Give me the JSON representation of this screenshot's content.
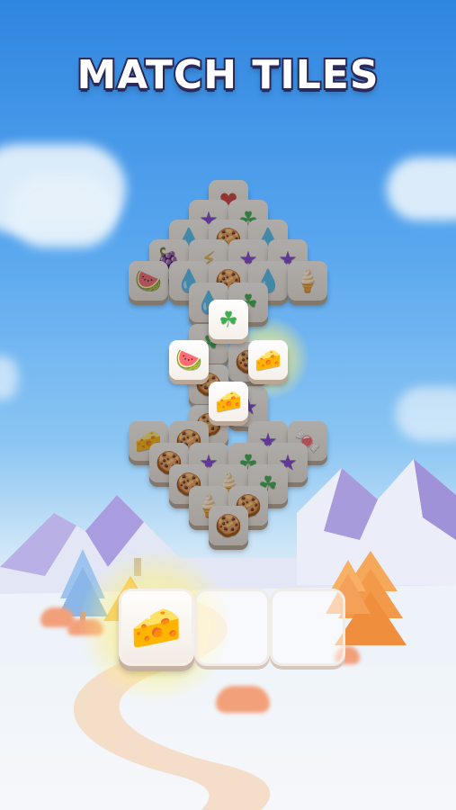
{
  "title": "MATCH TILES",
  "icons": [
    "heart-icon",
    "star-icon",
    "clover-icon",
    "grapes-icon",
    "cookie-icon",
    "lightning-icon",
    "drop-icon",
    "watermelon-icon",
    "cheese-icon",
    "candy-icon",
    "ice-cream-icon"
  ],
  "tray": {
    "slots": [
      {
        "icon": "cheese-icon",
        "glyph": "🧀",
        "filled": true
      },
      {
        "icon": "",
        "glyph": "",
        "filled": false
      },
      {
        "icon": "",
        "glyph": "",
        "filled": false
      }
    ]
  },
  "colors": {
    "sky_top": "#2f86e0",
    "title_outline": "#2c2a5a",
    "tile_face": "#f2eee9",
    "tile_edge": "#b9a694"
  }
}
